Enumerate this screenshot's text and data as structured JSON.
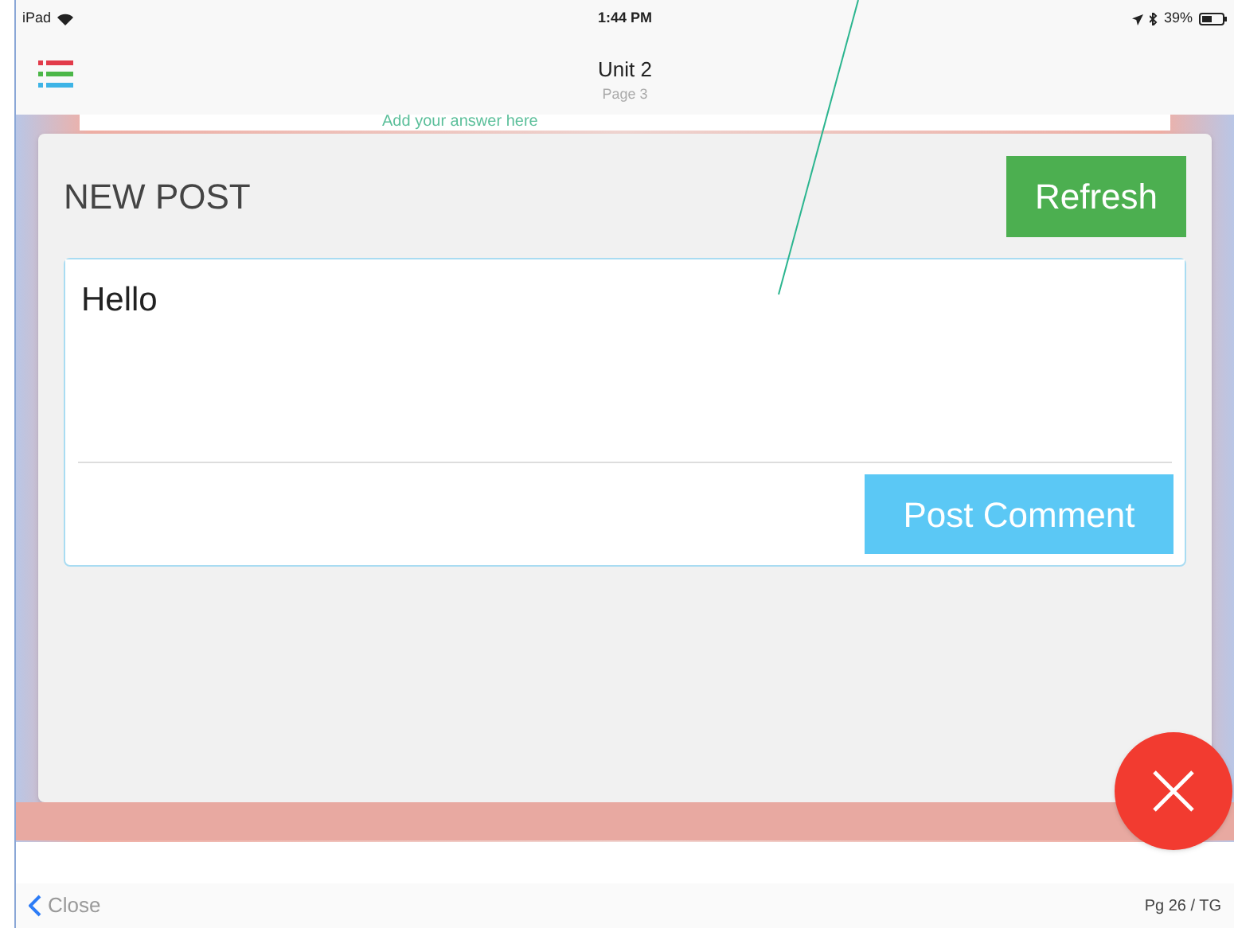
{
  "status_bar": {
    "device": "iPad",
    "time": "1:44 PM",
    "battery": "39%"
  },
  "header": {
    "title": "Unit 2",
    "subtitle": "Page 3"
  },
  "behind": {
    "prompt": "Add your answer here"
  },
  "dialog": {
    "title": "NEW POST",
    "refresh": "Refresh",
    "field": {
      "value": "Hello"
    },
    "submit": "Post Comment"
  },
  "footer": {
    "close": "Close",
    "page": "Pg 26 / TG"
  }
}
